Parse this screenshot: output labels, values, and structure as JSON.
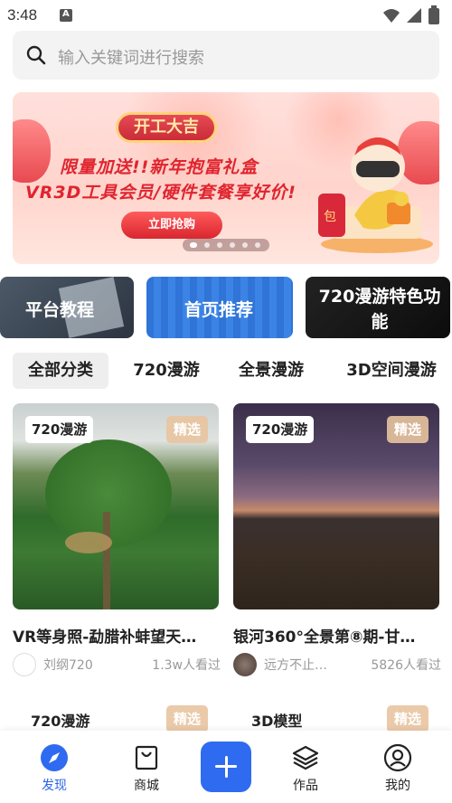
{
  "status_bar": {
    "time": "3:48"
  },
  "search": {
    "placeholder": "输入关键词进行搜索"
  },
  "banner": {
    "tag": "开工大吉",
    "headline1": "限量加送!!新年抱富礼盒",
    "headline2": "VR3D工具会员/硬件套餐享好价!",
    "cta": "立即抢购",
    "dot_count": 6,
    "active_dot": 0
  },
  "categories": [
    {
      "label": "平台教程"
    },
    {
      "label": "首页推荐"
    },
    {
      "label": "720漫游特色功能"
    }
  ],
  "tabs": [
    {
      "label": "全部分类",
      "active": true
    },
    {
      "label": "720漫游"
    },
    {
      "label": "全景漫游"
    },
    {
      "label": "3D空间漫游"
    }
  ],
  "cards": [
    {
      "badge": "720漫游",
      "pick": "精选",
      "title": "VR等身照-勐腊补蚌望天…",
      "author": "刘纲720",
      "views": "1.3w人看过"
    },
    {
      "badge": "720漫游",
      "pick": "精选",
      "title": "银河360°全景第⑧期-甘…",
      "author": "远方不止…",
      "views": "5826人看过"
    }
  ],
  "cards_row2": [
    {
      "badge": "720漫游",
      "pick": "精选"
    },
    {
      "badge": "3D模型",
      "pick": "精选"
    }
  ],
  "bottom_nav": [
    {
      "label": "发现",
      "active": true
    },
    {
      "label": "商城"
    },
    {
      "label": "作品"
    },
    {
      "label": "我的"
    }
  ],
  "colors": {
    "accent": "#2f6bf0",
    "banner_red": "#e0242f",
    "pick_tag": "#e8c4a0"
  }
}
